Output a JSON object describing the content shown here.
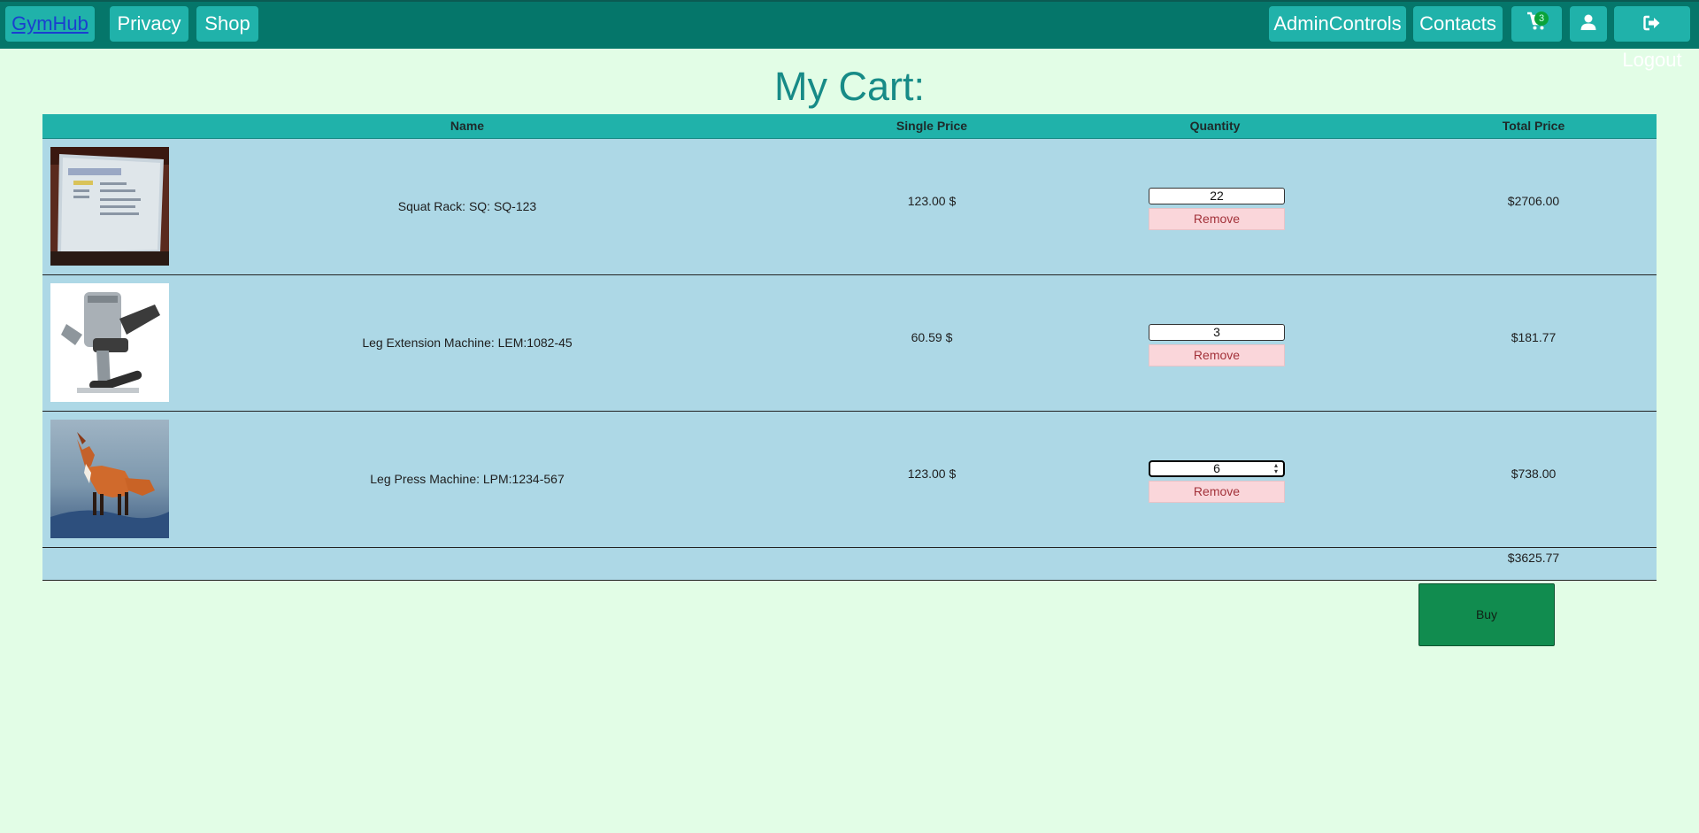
{
  "nav": {
    "brand": "GymHub",
    "privacy": "Privacy",
    "shop": "Shop",
    "admin": "AdminControls",
    "contacts": "Contacts",
    "cart_count": "3",
    "logout": "Logout"
  },
  "page": {
    "title": "My Cart:"
  },
  "table": {
    "headers": {
      "name": "Name",
      "single_price": "Single Price",
      "quantity": "Quantity",
      "total_price": "Total Price"
    },
    "remove_label": "Remove",
    "rows": [
      {
        "name": "Squat Rack: SQ: SQ-123",
        "single_price": "123.00 $",
        "quantity": "22",
        "total": "$2706.00"
      },
      {
        "name": "Leg Extension Machine: LEM:1082-45",
        "single_price": "60.59 $",
        "quantity": "3",
        "total": "$181.77"
      },
      {
        "name": "Leg Press Machine: LPM:1234-567",
        "single_price": "123.00 $",
        "quantity": "6",
        "total": "$738.00"
      }
    ],
    "grand_total": "$3625.77"
  },
  "buy_label": "Buy",
  "colors": {
    "navbar": "#05766a",
    "nav_button": "#20b2aa",
    "background": "#e2fde6",
    "row": "#add8e6",
    "buy": "#118c4f",
    "remove": "#fad6da"
  }
}
